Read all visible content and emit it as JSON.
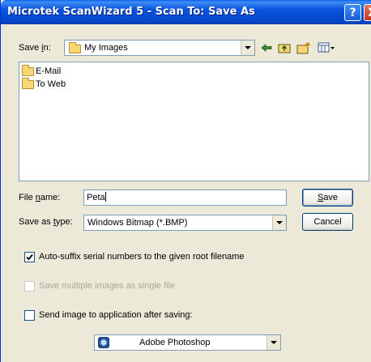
{
  "window": {
    "title": "Microtek ScanWizard 5 - Scan To: Save As",
    "help_glyph": "?",
    "close_glyph": "X"
  },
  "save_in": {
    "label_pre": "Save ",
    "label_ul": "i",
    "label_post": "n:",
    "folder": "My Images"
  },
  "toolbar": {
    "icons": [
      "back-icon",
      "up-folder-icon",
      "new-folder-icon",
      "view-menu-icon"
    ]
  },
  "file_list": {
    "items": [
      {
        "name": "E-Mail"
      },
      {
        "name": "To Web"
      }
    ]
  },
  "file_name": {
    "label_pre": "File ",
    "label_ul": "n",
    "label_post": "ame:",
    "value": "Peta"
  },
  "save_as_type": {
    "label_pre": "Save as ",
    "label_ul": "t",
    "label_post": "ype:",
    "value": "Windows Bitmap (*.BMP)"
  },
  "buttons": {
    "save_ul": "S",
    "save_rest": "ave",
    "cancel": "Cancel"
  },
  "options": {
    "auto_suffix": {
      "label": "Auto-suffix serial numbers to the given root filename",
      "checked": true,
      "enabled": true
    },
    "multiple_single": {
      "label": "Save multiple images as single file",
      "checked": false,
      "enabled": false
    },
    "send_to_app": {
      "label": "Send image to application after saving:",
      "checked": false,
      "enabled": true
    }
  },
  "application": {
    "value": "Adobe Photoshop"
  }
}
